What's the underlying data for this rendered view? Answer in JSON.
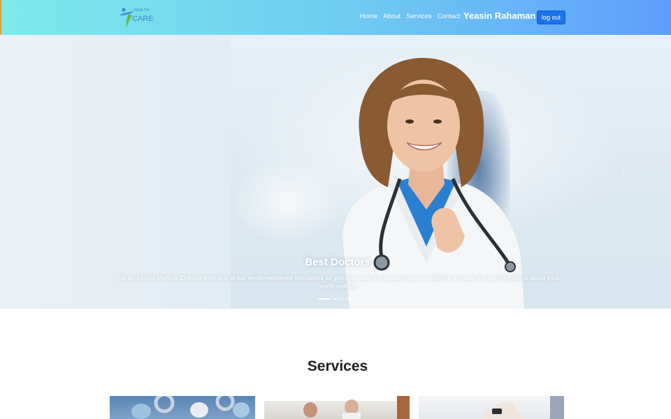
{
  "brand": {
    "small": "HEALTH",
    "large": "CARE"
  },
  "nav": {
    "links": [
      "Home",
      "About",
      "Services",
      "Contact"
    ],
    "user_name": "Yeasin Rahaman",
    "logout_label": "log out"
  },
  "hero": {
    "title": "Best Doctors",
    "text": "Get an Expert Medical Opinion from one of our world-renowned specialists so you can have the answers and confidence to make the right decisions about your health with us.",
    "slide_count": 3,
    "active_slide": 1
  },
  "services": {
    "title": "Services"
  },
  "colors": {
    "nav_gradient_start": "#7eeaea",
    "nav_gradient_end": "#5d9efc",
    "logout_button": "#1a73e8"
  }
}
